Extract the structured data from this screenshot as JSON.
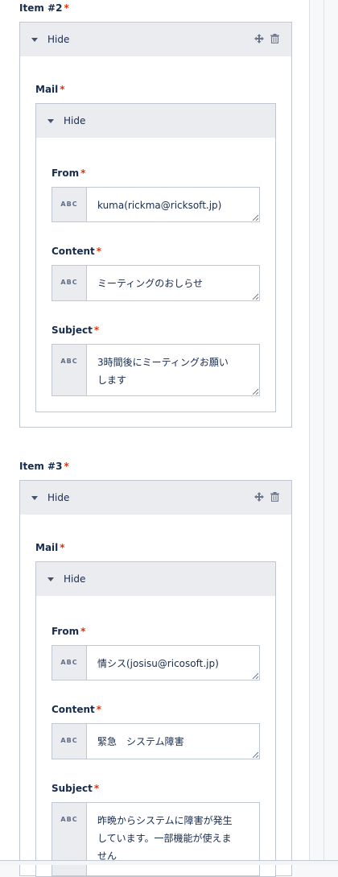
{
  "items": [
    {
      "label": "Item #2",
      "hide_label": "Hide",
      "mail_label": "Mail",
      "mail_hide_label": "Hide",
      "fields": [
        {
          "label": "From",
          "prefix": "ABC",
          "value": "kuma(rickma@ricksoft.jp)"
        },
        {
          "label": "Content",
          "prefix": "ABC",
          "value": "ミーティングのおしらせ"
        },
        {
          "label": "Subject",
          "prefix": "ABC",
          "value": "3時間後にミーティングお願い\nします"
        }
      ]
    },
    {
      "label": "Item #3",
      "hide_label": "Hide",
      "mail_label": "Mail",
      "mail_hide_label": "Hide",
      "fields": [
        {
          "label": "From",
          "prefix": "ABC",
          "value": "情シス(josisu@ricosoft.jp)"
        },
        {
          "label": "Content",
          "prefix": "ABC",
          "value": "緊急　システム障害"
        },
        {
          "label": "Subject",
          "prefix": "ABC",
          "value": "昨晩からシステムに障害が発生\nしています。一部機能が使えま\nせん"
        }
      ]
    }
  ],
  "required_marker": "*",
  "icons": {
    "move": "move-icon",
    "delete": "trash-icon",
    "collapse": "caret-down-icon",
    "resize": "resize-handle-icon"
  },
  "colors": {
    "required": "#de350b",
    "header_bg": "#ebecf0",
    "border": "#c1c7d0"
  }
}
